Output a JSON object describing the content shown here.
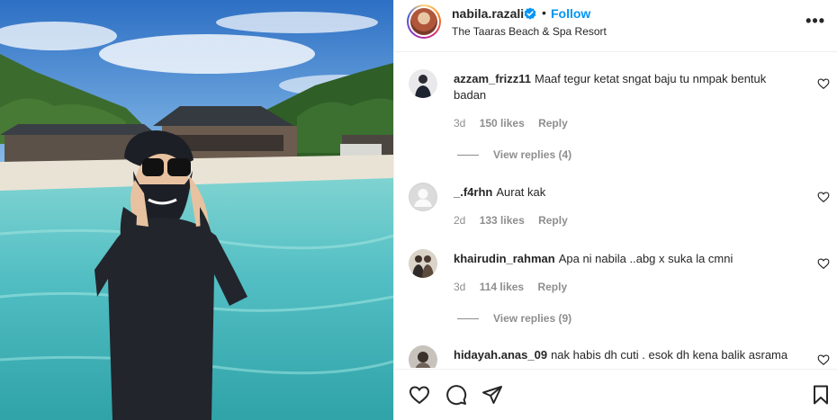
{
  "header": {
    "username": "nabila.razali",
    "separator": "•",
    "follow_label": "Follow",
    "location": "The Taaras Beach & Spa Resort",
    "more_label": "•••"
  },
  "comments": [
    {
      "user": "azzam_frizz11",
      "text": "Maaf tegur ketat sngat baju tu nmpak bentuk badan",
      "time": "3d",
      "likes": "150 likes",
      "reply": "Reply",
      "view_replies": "View replies (4)"
    },
    {
      "user": "_.f4rhn",
      "text": "Aurat kak",
      "time": "2d",
      "likes": "133 likes",
      "reply": "Reply"
    },
    {
      "user": "khairudin_rahman",
      "text": "Apa ni nabila ..abg x suka la cmni",
      "time": "3d",
      "likes": "114 likes",
      "reply": "Reply",
      "view_replies": "View replies (9)"
    },
    {
      "user": "hidayah.anas_09",
      "text": "nak habis dh cuti . esok dh kena balik asrama"
    }
  ],
  "icons": {
    "verified": "verified-badge-icon",
    "like": "heart-icon",
    "comment": "comment-icon",
    "share": "share-icon",
    "save": "bookmark-icon"
  },
  "colors": {
    "accent": "#0095f6",
    "text": "#262626",
    "secondary": "#8e8e8e"
  }
}
